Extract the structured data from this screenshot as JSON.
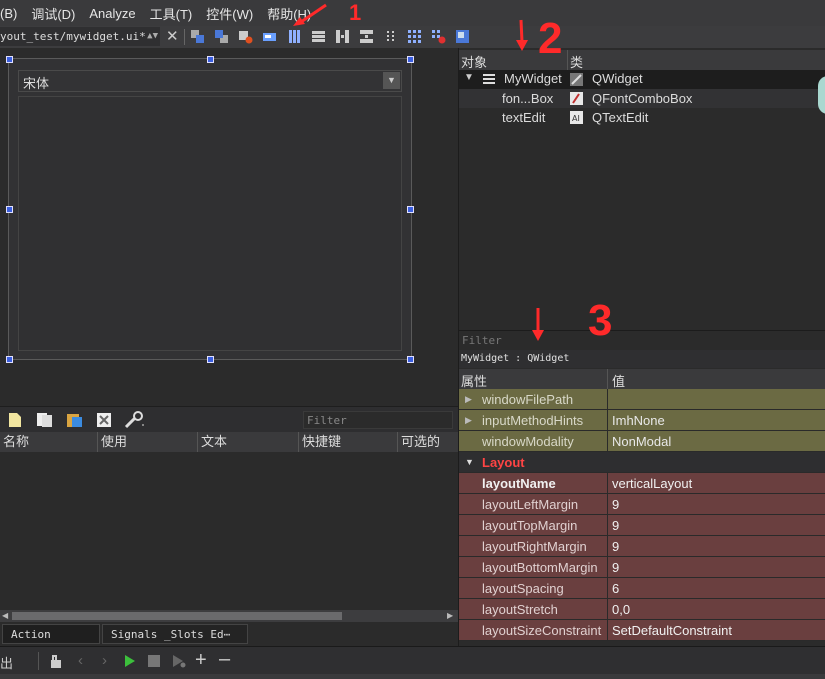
{
  "menu": {
    "items": [
      "(B)",
      "调试(D)",
      "Analyze",
      "工具(T)",
      "控件(W)",
      "帮助(H)"
    ]
  },
  "toolbar": {
    "file_path": "yout_test/mywidget.ui*",
    "close_symbol": "✕",
    "icons": [
      "send-to-back-icon",
      "bring-to-front-icon",
      "edit-signals-icon",
      "edit-buddies-icon",
      "layout-horizontal-icon",
      "layout-vertical-icon",
      "layout-h-splitter-icon",
      "layout-v-splitter-icon",
      "layout-form-icon",
      "layout-grid-icon",
      "break-layout-icon",
      "adjust-size-icon"
    ]
  },
  "form": {
    "font_combo_value": "宋体"
  },
  "action_editor": {
    "filter_placeholder": "Filter",
    "columns": [
      "名称",
      "使用",
      "文本",
      "快捷键",
      "可选的"
    ]
  },
  "bottom_tabs": {
    "action_editor": "Action Editor",
    "signals_slots": "Signals _Slots Ed⋯"
  },
  "object_inspector": {
    "header_object": "对象",
    "header_class": "类",
    "rows": [
      {
        "name": "MyWidget",
        "class": "QWidget"
      },
      {
        "name": "fon...Box",
        "class": "QFontComboBox"
      },
      {
        "name": "textEdit",
        "class": "QTextEdit"
      }
    ]
  },
  "property_editor": {
    "filter_placeholder": "Filter",
    "object_label": "MyWidget : QWidget",
    "header_property": "属性",
    "header_value": "值",
    "rows": [
      {
        "name": "windowFilePath",
        "value": "",
        "expandable": true
      },
      {
        "name": "inputMethodHints",
        "value": "ImhNone",
        "expandable": true
      },
      {
        "name": "windowModality",
        "value": "NonModal",
        "expandable": false
      },
      {
        "name": "Layout",
        "value": "",
        "section": true
      },
      {
        "name": "layoutName",
        "value": "verticalLayout",
        "bold": true
      },
      {
        "name": "layoutLeftMargin",
        "value": "9"
      },
      {
        "name": "layoutTopMargin",
        "value": "9"
      },
      {
        "name": "layoutRightMargin",
        "value": "9"
      },
      {
        "name": "layoutBottomMargin",
        "value": "9"
      },
      {
        "name": "layoutSpacing",
        "value": "6"
      },
      {
        "name": "layoutStretch",
        "value": "0,0"
      },
      {
        "name": "layoutSizeConstraint",
        "value": "SetDefaultConstraint"
      }
    ]
  },
  "status_bar": {
    "left_text": "出",
    "icons": [
      "build-icon",
      "back-arrow-icon",
      "forward-arrow-icon",
      "run-icon",
      "stop-icon",
      "debug-icon",
      "plus-icon",
      "minus-icon"
    ]
  },
  "annotations": {
    "mark_1": "1",
    "mark_2": "2",
    "mark_3": "3"
  },
  "colors": {
    "accent_red": "#ff2a2a",
    "selection_handle": "#3b5fdf",
    "property_olive": "#6b6a43",
    "property_rose": "#6a3f3f",
    "section_red": "#ff4444"
  }
}
